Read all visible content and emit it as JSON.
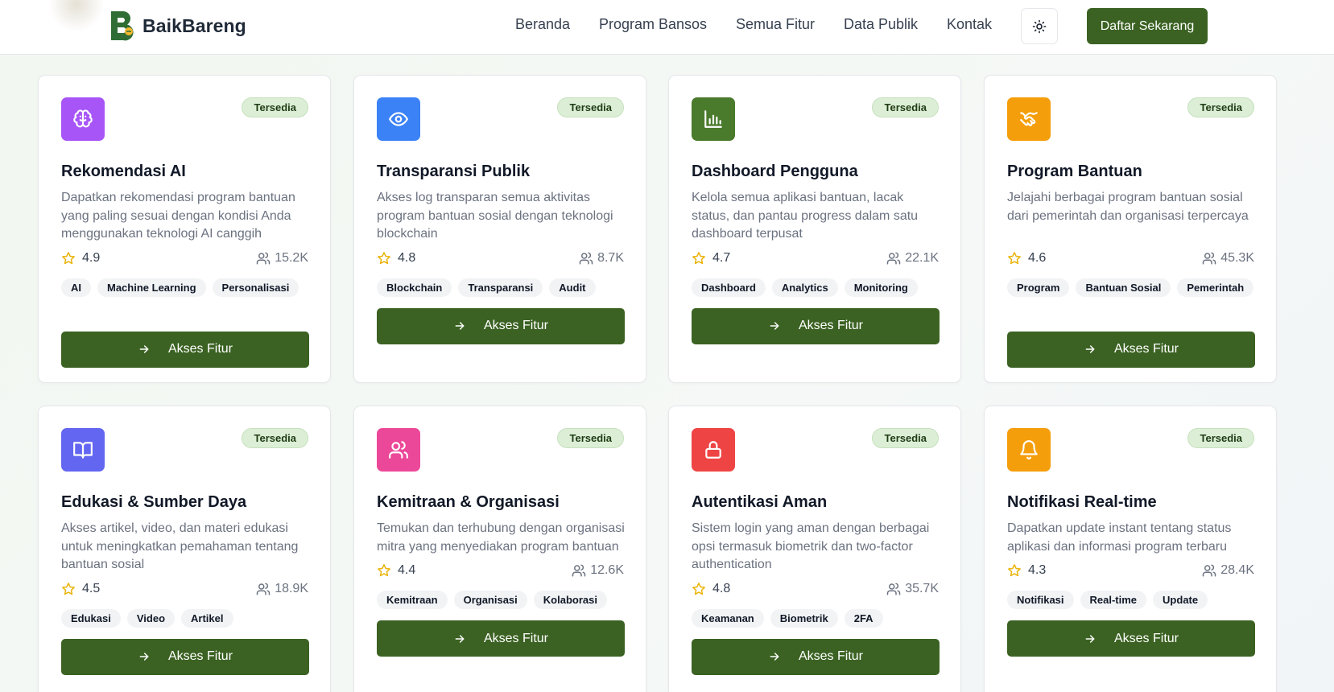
{
  "header": {
    "brand": "BaikBareng",
    "nav": [
      "Beranda",
      "Program Bansos",
      "Semua Fitur",
      "Data Publik",
      "Kontak"
    ],
    "cta_label": "Daftar Sekarang"
  },
  "cards": [
    {
      "title": "Rekomendasi AI",
      "badge": "Tersedia",
      "description": "Dapatkan rekomendasi program bantuan yang paling sesuai dengan kondisi Anda menggunakan teknologi AI canggih",
      "rating": "4.9",
      "users": "15.2K",
      "tags": [
        "AI",
        "Machine Learning",
        "Personalisasi"
      ],
      "button": "Akses Fitur",
      "icon": "brain-icon",
      "color": "#a855f7"
    },
    {
      "title": "Transparansi Publik",
      "badge": "Tersedia",
      "description": "Akses log transparan semua aktivitas program bantuan sosial dengan teknologi blockchain",
      "rating": "4.8",
      "users": "8.7K",
      "tags": [
        "Blockchain",
        "Transparansi",
        "Audit"
      ],
      "button": "Akses Fitur",
      "icon": "eye-icon",
      "color": "#3b82f6"
    },
    {
      "title": "Dashboard Pengguna",
      "badge": "Tersedia",
      "description": "Kelola semua aplikasi bantuan, lacak status, dan pantau progress dalam satu dashboard terpusat",
      "rating": "4.7",
      "users": "22.1K",
      "tags": [
        "Dashboard",
        "Analytics",
        "Monitoring"
      ],
      "button": "Akses Fitur",
      "icon": "bar-chart-icon",
      "color": "#4a7a2c"
    },
    {
      "title": "Program Bantuan",
      "badge": "Tersedia",
      "description": "Jelajahi berbagai program bantuan sosial dari pemerintah dan organisasi terpercaya",
      "rating": "4.6",
      "users": "45.3K",
      "tags": [
        "Program",
        "Bantuan Sosial",
        "Pemerintah"
      ],
      "button": "Akses Fitur",
      "icon": "handshake-icon",
      "color": "#f59e0b"
    },
    {
      "title": "Edukasi & Sumber Daya",
      "badge": "Tersedia",
      "description": "Akses artikel, video, dan materi edukasi untuk meningkatkan pemahaman tentang bantuan sosial",
      "rating": "4.5",
      "users": "18.9K",
      "tags": [
        "Edukasi",
        "Video",
        "Artikel"
      ],
      "button": "Akses Fitur",
      "icon": "book-open-icon",
      "color": "#6366f1"
    },
    {
      "title": "Kemitraan & Organisasi",
      "badge": "Tersedia",
      "description": "Temukan dan terhubung dengan organisasi mitra yang menyediakan program bantuan",
      "rating": "4.4",
      "users": "12.6K",
      "tags": [
        "Kemitraan",
        "Organisasi",
        "Kolaborasi"
      ],
      "button": "Akses Fitur",
      "icon": "users-icon",
      "color": "#ec4899"
    },
    {
      "title": "Autentikasi Aman",
      "badge": "Tersedia",
      "description": "Sistem login yang aman dengan berbagai opsi termasuk biometrik dan two-factor authentication",
      "rating": "4.8",
      "users": "35.7K",
      "tags": [
        "Keamanan",
        "Biometrik",
        "2FA"
      ],
      "button": "Akses Fitur",
      "icon": "lock-icon",
      "color": "#ef4444"
    },
    {
      "title": "Notifikasi Real-time",
      "badge": "Tersedia",
      "description": "Dapatkan update instant tentang status aplikasi dan informasi program terbaru",
      "rating": "4.3",
      "users": "28.4K",
      "tags": [
        "Notifikasi",
        "Real-time",
        "Update"
      ],
      "button": "Akses Fitur",
      "icon": "bell-icon",
      "color": "#f59e0b"
    }
  ]
}
